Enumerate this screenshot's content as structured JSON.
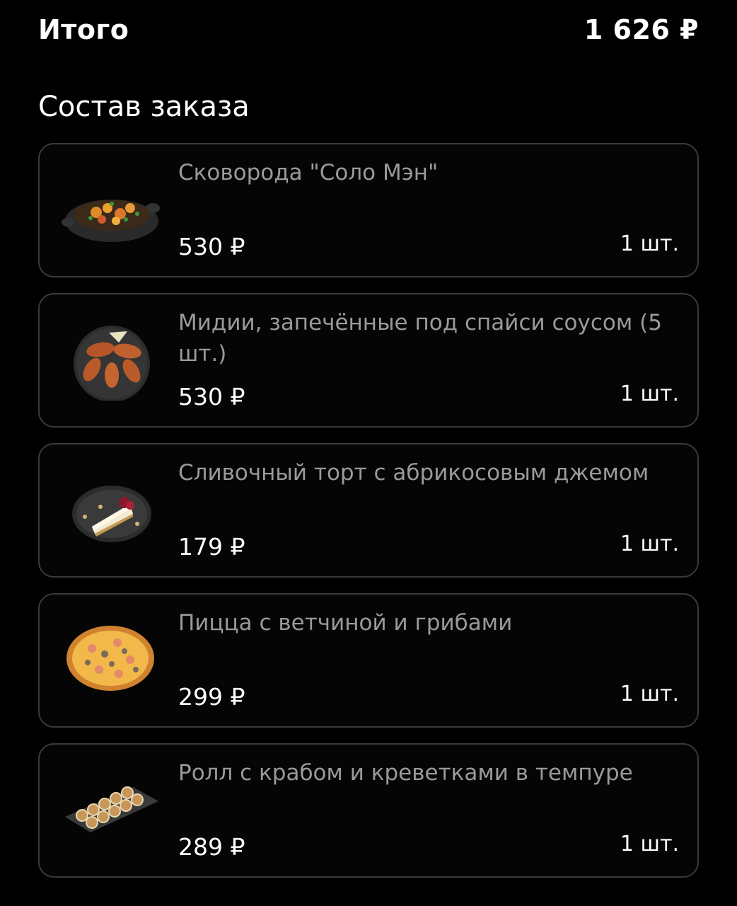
{
  "summary": {
    "total_label": "Итого",
    "total_value": "1 626 ₽"
  },
  "order": {
    "title": "Состав заказа",
    "items": [
      {
        "name": "Сковорода \"Соло Мэн\"",
        "price": "530 ₽",
        "qty": "1 шт.",
        "image": "skillet-dish-image"
      },
      {
        "name": "Мидии, запечённые под спайси соусом (5 шт.)",
        "price": "530 ₽",
        "qty": "1 шт.",
        "image": "mussels-plate-image"
      },
      {
        "name": "Сливочный торт с абрикосовым джемом",
        "price": "179 ₽",
        "qty": "1 шт.",
        "image": "cake-slice-image"
      },
      {
        "name": "Пицца с ветчиной и грибами",
        "price": "299 ₽",
        "qty": "1 шт.",
        "image": "pizza-image"
      },
      {
        "name": "Ролл с крабом и креветками в темпуре",
        "price": "289 ₽",
        "qty": "1 шт.",
        "image": "tempura-roll-image"
      }
    ]
  }
}
